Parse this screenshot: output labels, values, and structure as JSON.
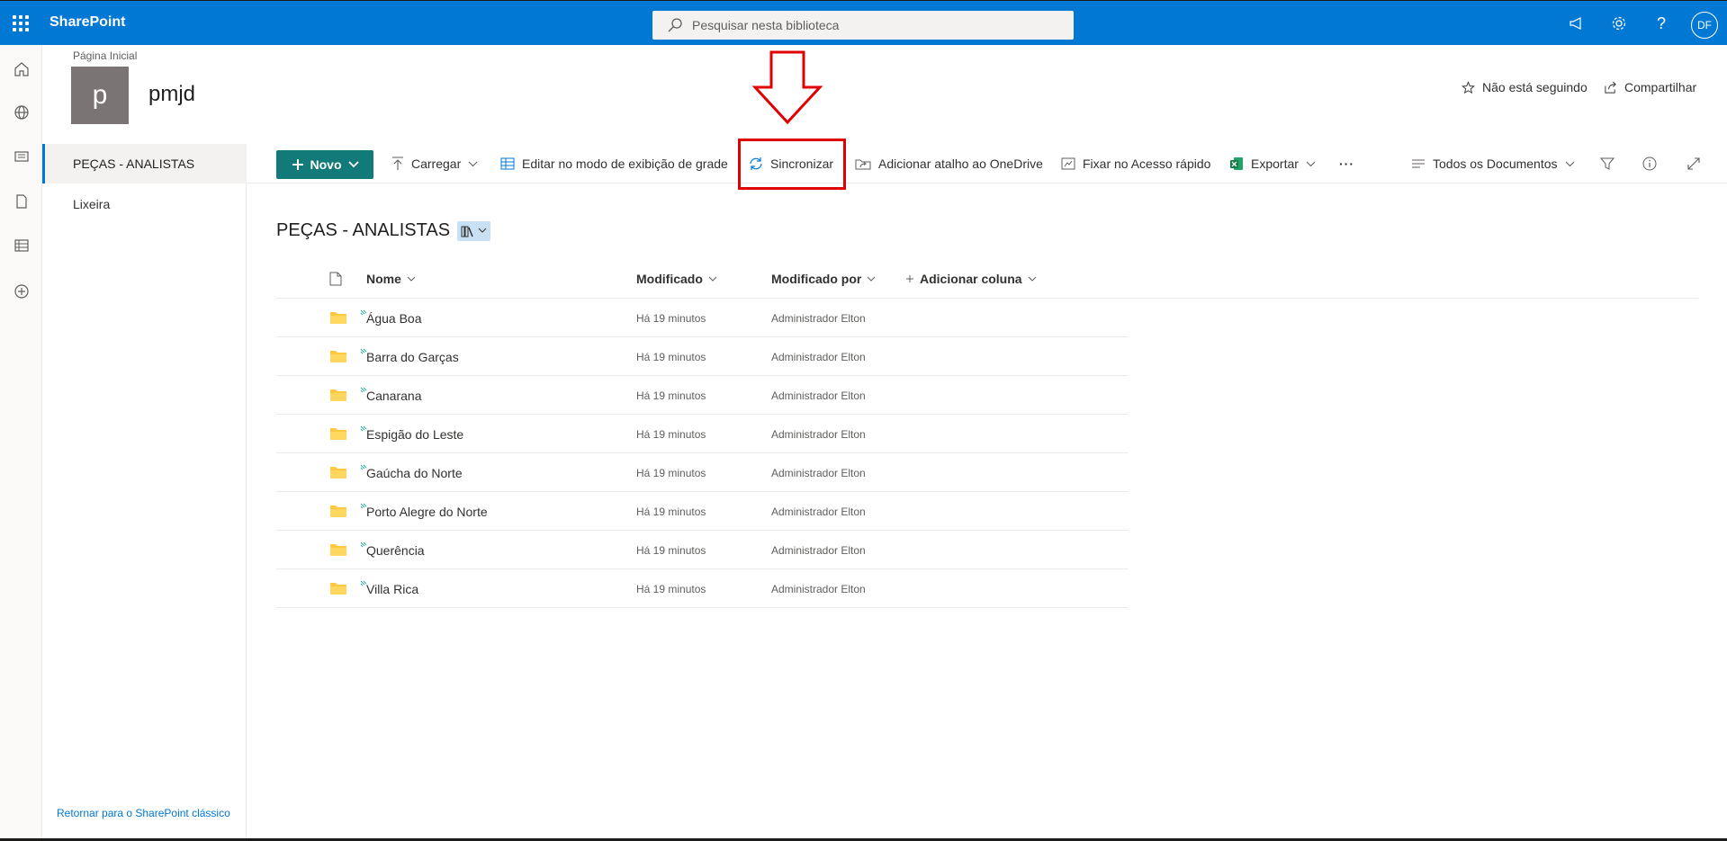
{
  "app": {
    "brand": "SharePoint",
    "avatar_initials": "DF"
  },
  "search": {
    "placeholder": "Pesquisar nesta biblioteca"
  },
  "site": {
    "breadcrumb": "Página Inicial",
    "logo_letter": "p",
    "title": "pmjd",
    "follow_label": "Não está seguindo",
    "share_label": "Compartilhar"
  },
  "leftnav": {
    "selected": "PEÇAS - ANALISTAS",
    "items": [
      "Lixeira"
    ],
    "classic_link": "Retornar para o SharePoint clássico"
  },
  "commandbar": {
    "new_label": "Novo",
    "upload_label": "Carregar",
    "grid_label": "Editar no modo de exibição de grade",
    "sync_label": "Sincronizar",
    "shortcut_label": "Adicionar atalho ao OneDrive",
    "pin_label": "Fixar no Acesso rápido",
    "export_label": "Exportar",
    "more_label": "···",
    "view_label": "Todos os Documentos"
  },
  "library": {
    "title": "PEÇAS - ANALISTAS",
    "columns": {
      "name": "Nome",
      "modified": "Modificado",
      "modified_by": "Modificado por",
      "add_column": "Adicionar coluna"
    },
    "rows": [
      {
        "name": "Água Boa",
        "modified": "Há 19 minutos",
        "modified_by": "Administrador Elton"
      },
      {
        "name": "Barra do Garças",
        "modified": "Há 19 minutos",
        "modified_by": "Administrador Elton"
      },
      {
        "name": "Canarana",
        "modified": "Há 19 minutos",
        "modified_by": "Administrador Elton"
      },
      {
        "name": "Espigão do Leste",
        "modified": "Há 19 minutos",
        "modified_by": "Administrador Elton"
      },
      {
        "name": "Gaúcha do Norte",
        "modified": "Há 19 minutos",
        "modified_by": "Administrador Elton"
      },
      {
        "name": "Porto Alegre do Norte",
        "modified": "Há 19 minutos",
        "modified_by": "Administrador Elton"
      },
      {
        "name": "Querência",
        "modified": "Há 19 minutos",
        "modified_by": "Administrador Elton"
      },
      {
        "name": "Villa Rica",
        "modified": "Há 19 minutos",
        "modified_by": "Administrador Elton"
      }
    ]
  },
  "colors": {
    "suite_bar": "#0078d4",
    "new_button": "#137a7a",
    "annotation": "#e00000",
    "folder": "#ffc83d"
  },
  "icons": [
    "waffle-icon",
    "search-icon",
    "megaphone-icon",
    "gear-icon",
    "help-icon",
    "home-icon",
    "globe-icon",
    "news-icon",
    "document-icon",
    "list-icon",
    "add-circle-icon",
    "star-icon",
    "share-icon",
    "plus-icon",
    "chevron-down-icon",
    "upload-icon",
    "grid-icon",
    "sync-icon",
    "onedrive-shortcut-icon",
    "pin-icon",
    "excel-icon",
    "filter-icon",
    "info-icon",
    "expand-icon",
    "folder-icon",
    "file-icon",
    "library-icon",
    "down-arrow-annotation"
  ]
}
